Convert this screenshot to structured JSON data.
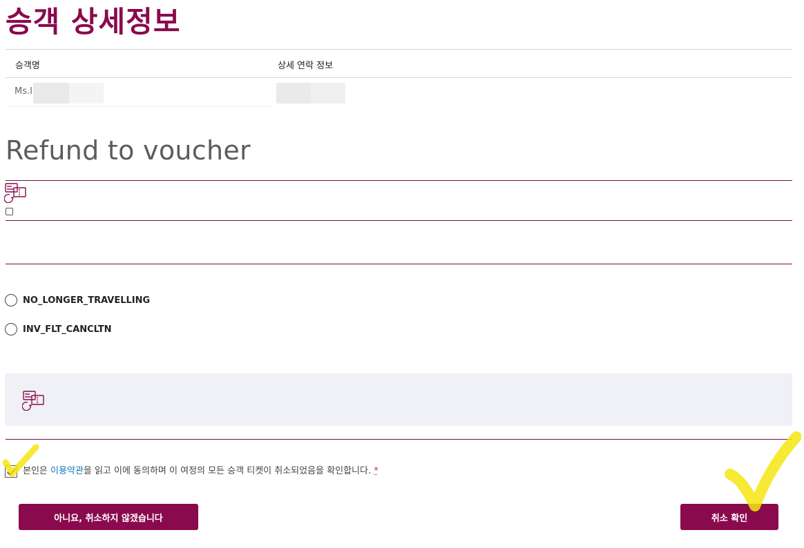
{
  "page": {
    "title": "승객 상세정보"
  },
  "passenger_table": {
    "col_name_header": "승객명",
    "col_contact_header": "상세 연락 정보",
    "row": {
      "name_prefix": "Ms.I"
    }
  },
  "refund": {
    "section_title": "Refund to voucher",
    "icon": "voucher-icon"
  },
  "reasons": {
    "options": [
      {
        "label": "NO_LONGER_TRAVELLING",
        "selected": false
      },
      {
        "label": "INV_FLT_CANCLTN",
        "selected": false
      }
    ]
  },
  "info_box": {
    "icon": "voucher-icon"
  },
  "agreement": {
    "checked": true,
    "text_before": "본인은 ",
    "link_text": "이용약관",
    "text_after": "을 읽고 이에 동의하며 이 여정의 모든 승객 티켓이 취소되었음을 확인합니다. ",
    "required_mark": "*"
  },
  "buttons": {
    "cancel_label": "아니요, 취소하지 않겠습니다",
    "confirm_label": "취소 확인"
  },
  "colors": {
    "brand": "#8a0a4e",
    "link": "#1475b9",
    "info_box_bg": "#f0f1f6",
    "highlighter": "#f5e612"
  }
}
